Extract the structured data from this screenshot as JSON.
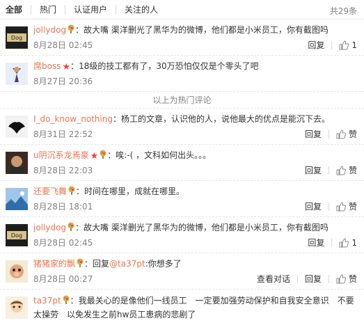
{
  "tabs": [
    {
      "label": "全部"
    },
    {
      "label": "热门"
    },
    {
      "label": "认证用户"
    },
    {
      "label": "关注的人"
    }
  ],
  "total": "共29条",
  "hot_divider": "以上为热门评论",
  "actions": {
    "reply": "回复",
    "like": "赞",
    "view_dialog": "查看对话"
  },
  "comments": [
    {
      "user": "jollydog",
      "text": "：故大嘴 渠洋删光了黑华为的微博，他们都是小米员工，你有截图吗",
      "time": "8月28日 02:45",
      "like_count": "1"
    },
    {
      "user": "席boss",
      "text": "：18级的技工都有了，30万恐怕仅仅是个零头了吧",
      "time": "8月27日 20:36"
    },
    {
      "user": "I_do_know_nothing",
      "text": "：杨工的文章，认识他的人，说他最大的优点是能沉下去。",
      "time": "8月31日 22:52"
    },
    {
      "user": "u阴沉系龙焉豪",
      "text": "：唉:-( ，文科如何出头。。。",
      "time": "8月28日 22:03"
    },
    {
      "user": "还要飞舞",
      "text": "：时间在哪里，成就在哪里。",
      "time": "8月28日 18:01"
    },
    {
      "user": "jollydog",
      "text": "：故大嘴 渠洋删光了黑华为的微博，他们都是小米员工，你有截图吗",
      "time": "8月28日 02:45",
      "like_count": "1"
    },
    {
      "user": "猪猪家的飘",
      "text_prefix": "：回复",
      "mention": "@ta37pt",
      "text": ":你想多了",
      "time": "8月28日 00:27"
    },
    {
      "user": "ta37pt",
      "text": "：我最关心的是像他们一线员工　一定要加强劳动保护和自我安全意识　不要太操劳　以免发生之前hw员工患病的悲剧了"
    }
  ]
}
